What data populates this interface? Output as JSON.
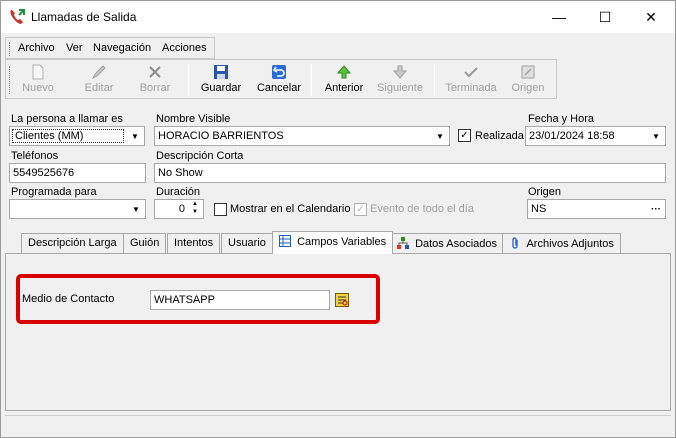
{
  "window": {
    "title": "Llamadas de Salida",
    "minimize_glyph": "—",
    "maximize_glyph": "☐",
    "close_glyph": "✕"
  },
  "menu": {
    "archivo": "Archivo",
    "ver": "Ver",
    "navegacion": "Navegación",
    "acciones": "Acciones"
  },
  "toolbar": {
    "nuevo": "Nuevo",
    "editar": "Editar",
    "borrar": "Borrar",
    "guardar": "Guardar",
    "cancelar": "Cancelar",
    "anterior": "Anterior",
    "siguiente": "Siguiente",
    "terminada": "Terminada",
    "origen": "Origen"
  },
  "form": {
    "persona_label": "La persona a llamar es",
    "persona_value": "Clientes (MM)",
    "nombre_label": "Nombre Visible",
    "nombre_value": "HORACIO BARRIENTOS",
    "realizada_label": "Realizada",
    "realizada_checked": true,
    "fecha_label": "Fecha y Hora",
    "fecha_value": "23/01/2024 18:58",
    "telefonos_label": "Teléfonos",
    "telefonos_value": "5549525676",
    "descripcion_label": "Descripción Corta",
    "descripcion_value": "No Show",
    "programada_label": "Programada para",
    "programada_value": "",
    "duracion_label": "Duración",
    "duracion_value": "0",
    "calendario_label": "Mostrar en el Calendario",
    "evento_label": "Evento de todo el día",
    "origen_label": "Origen",
    "origen_value": "NS",
    "ellipsis": "···"
  },
  "tabs": [
    {
      "label": "Descripción Larga"
    },
    {
      "label": "Guión"
    },
    {
      "label": "Intentos"
    },
    {
      "label": "Usuario"
    },
    {
      "label": "Campos Variables"
    },
    {
      "label": "Datos Asociados"
    },
    {
      "label": "Archivos Adjuntos"
    }
  ],
  "campos": {
    "medio_label": "Medio de Contacto",
    "medio_value": "WHATSAPP"
  },
  "colors": {
    "highlight_border": "#d90000",
    "accent_blue": "#1e5fc7"
  }
}
